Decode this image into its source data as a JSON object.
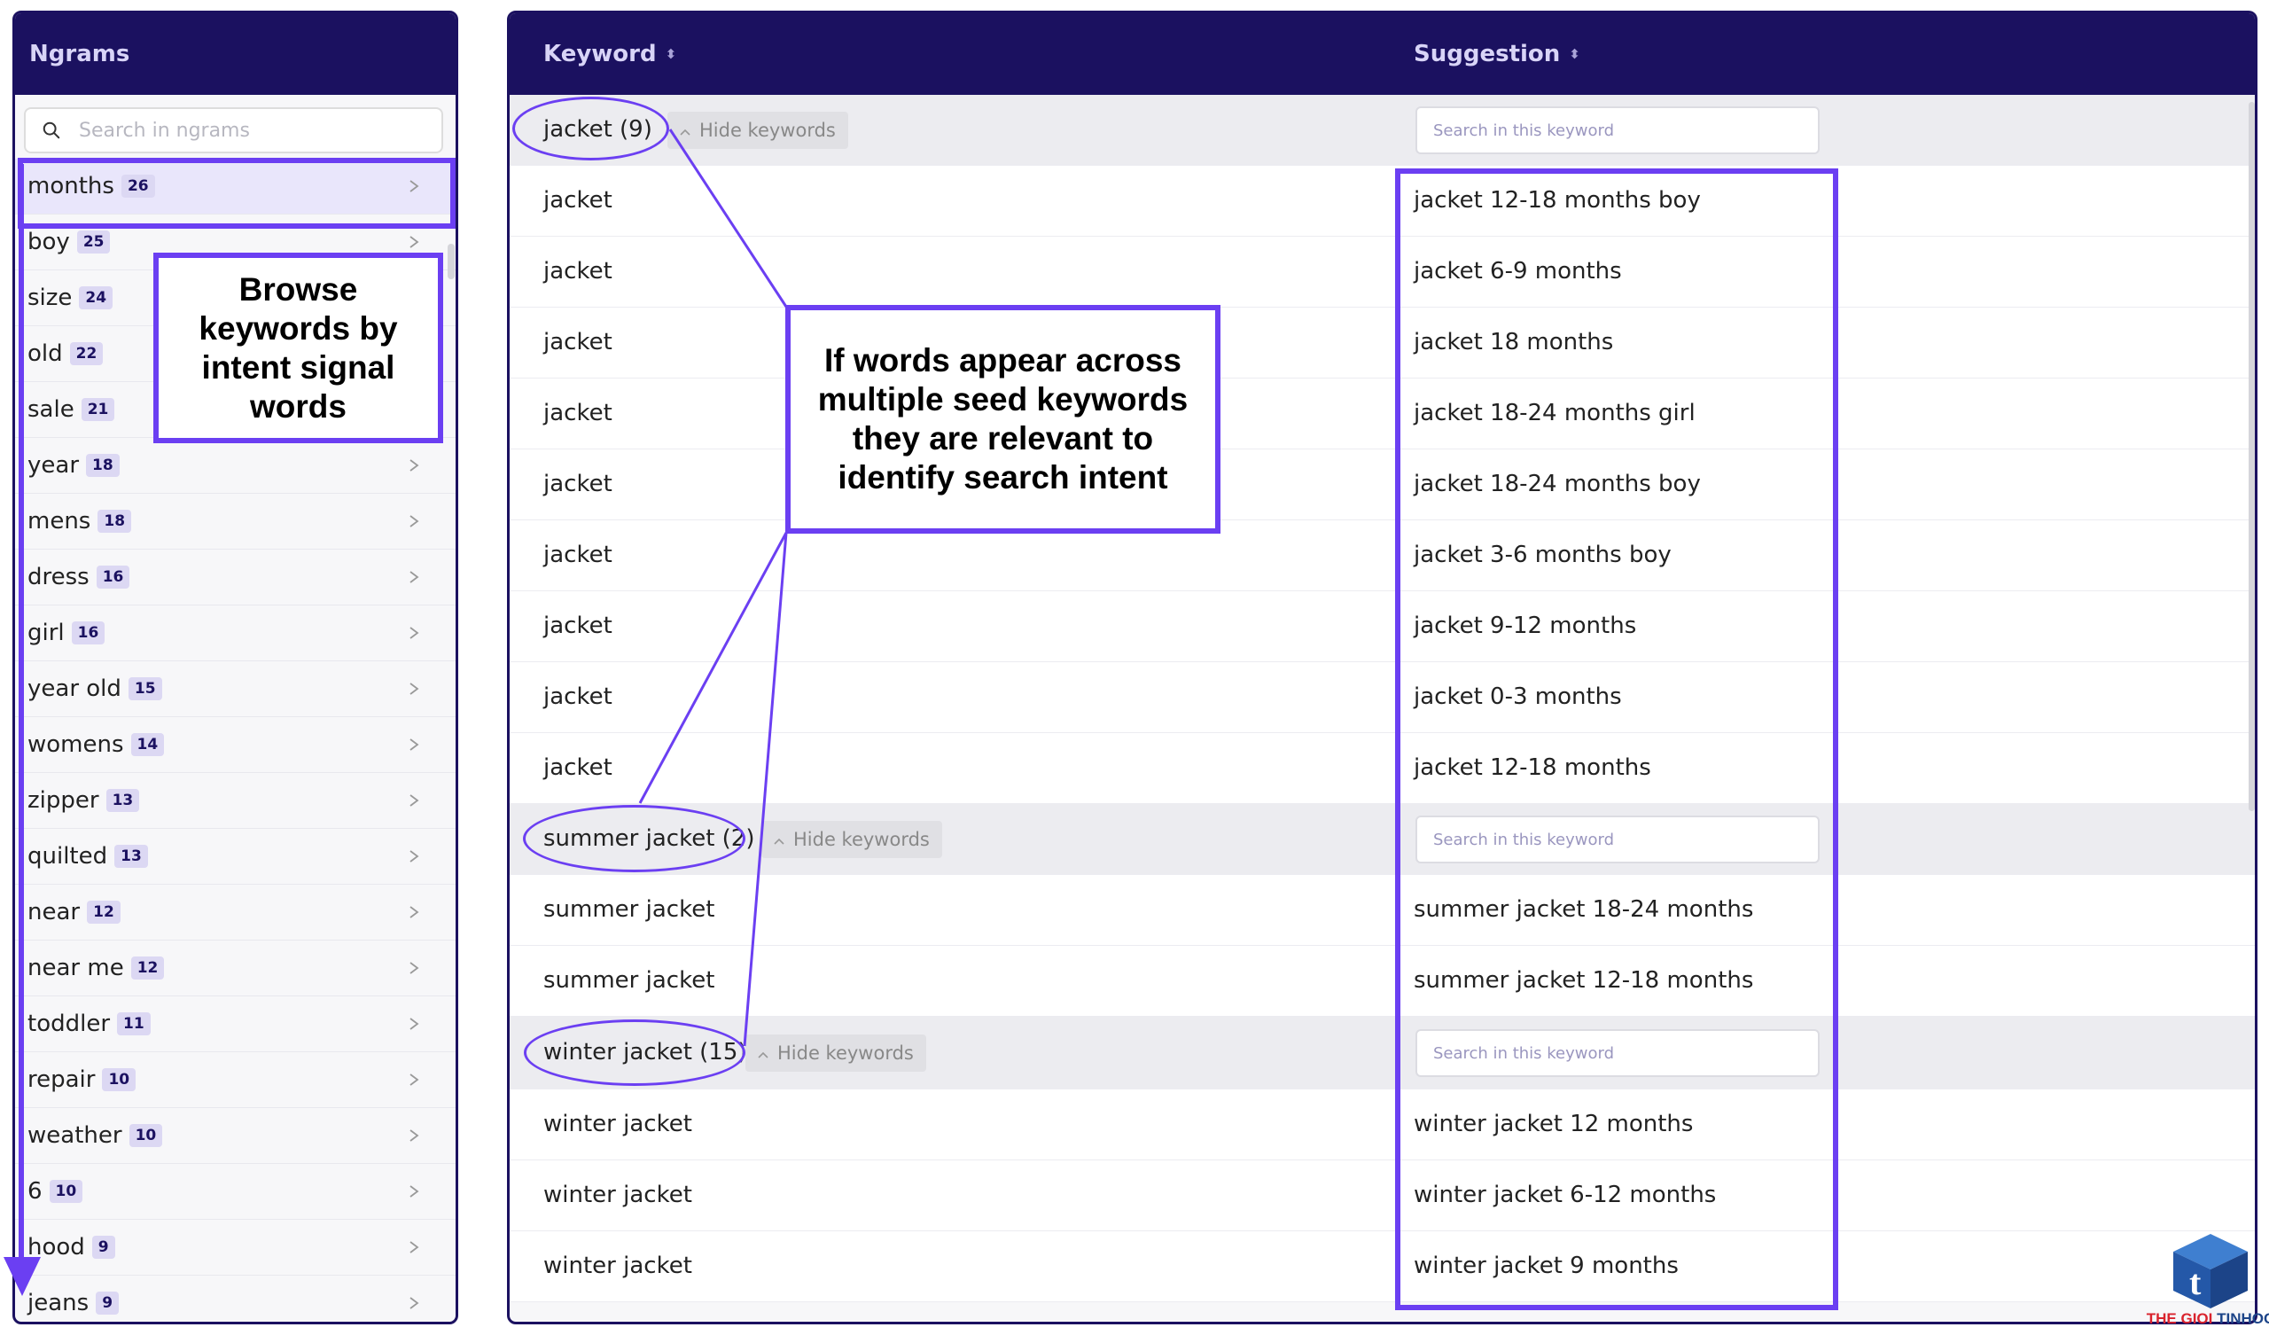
{
  "ngrams_panel": {
    "title": "Ngrams",
    "search_placeholder": "Search in ngrams",
    "items": [
      {
        "term": "months",
        "count": "26"
      },
      {
        "term": "boy",
        "count": "25"
      },
      {
        "term": "size",
        "count": "24"
      },
      {
        "term": "old",
        "count": "22"
      },
      {
        "term": "sale",
        "count": "21"
      },
      {
        "term": "year",
        "count": "18"
      },
      {
        "term": "mens",
        "count": "18"
      },
      {
        "term": "dress",
        "count": "16"
      },
      {
        "term": "girl",
        "count": "16"
      },
      {
        "term": "year old",
        "count": "15"
      },
      {
        "term": "womens",
        "count": "14"
      },
      {
        "term": "zipper",
        "count": "13"
      },
      {
        "term": "quilted",
        "count": "13"
      },
      {
        "term": "near",
        "count": "12"
      },
      {
        "term": "near me",
        "count": "12"
      },
      {
        "term": "toddler",
        "count": "11"
      },
      {
        "term": "repair",
        "count": "10"
      },
      {
        "term": "weather",
        "count": "10"
      },
      {
        "term": "6",
        "count": "10"
      },
      {
        "term": "hood",
        "count": "9"
      },
      {
        "term": "jeans",
        "count": "9"
      }
    ]
  },
  "keywords_table": {
    "columns": {
      "keyword": "Keyword",
      "suggestion": "Suggestion"
    },
    "hide_label": "Hide keywords",
    "search_placeholder": "Search in this keyword",
    "groups": [
      {
        "label": "jacket (9)",
        "rows": [
          {
            "keyword": "jacket",
            "suggestion": "jacket 12-18 months boy"
          },
          {
            "keyword": "jacket",
            "suggestion": "jacket 6-9 months"
          },
          {
            "keyword": "jacket",
            "suggestion": "jacket 18 months"
          },
          {
            "keyword": "jacket",
            "suggestion": "jacket 18-24 months girl"
          },
          {
            "keyword": "jacket",
            "suggestion": "jacket 18-24 months boy"
          },
          {
            "keyword": "jacket",
            "suggestion": "jacket 3-6 months boy"
          },
          {
            "keyword": "jacket",
            "suggestion": "jacket 9-12 months"
          },
          {
            "keyword": "jacket",
            "suggestion": "jacket 0-3 months"
          },
          {
            "keyword": "jacket",
            "suggestion": "jacket 12-18 months"
          }
        ]
      },
      {
        "label": "summer jacket (2)",
        "rows": [
          {
            "keyword": "summer jacket",
            "suggestion": "summer jacket 18-24 months"
          },
          {
            "keyword": "summer jacket",
            "suggestion": "summer jacket 12-18 months"
          }
        ]
      },
      {
        "label": "winter jacket (15)",
        "rows": [
          {
            "keyword": "winter jacket",
            "suggestion": "winter jacket 12 months"
          },
          {
            "keyword": "winter jacket",
            "suggestion": "winter jacket 6-12 months"
          },
          {
            "keyword": "winter jacket",
            "suggestion": "winter jacket 9 months"
          }
        ]
      }
    ]
  },
  "annotations": {
    "browse": "Browse keywords by intent signal words",
    "relevance": "If words appear across multiple seed keywords they are relevant to identify search intent"
  },
  "watermark": {
    "part1": "THE GIOI ",
    "part2": "TINHOC"
  },
  "colors": {
    "header": "#1b1160",
    "accent": "#6b3ff2",
    "badge": "#dcd8f3"
  }
}
